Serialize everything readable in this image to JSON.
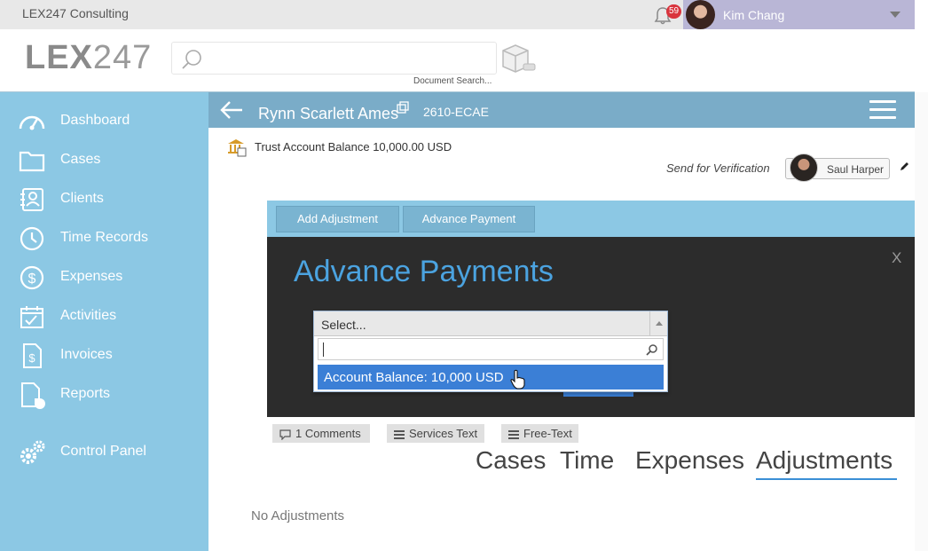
{
  "topbar": {
    "company": "LEX247 Consulting",
    "notification_count": "59",
    "user_name": "Kim Chang"
  },
  "logo": {
    "part1": "LEX",
    "part2": "247"
  },
  "search": {
    "placeholder": "",
    "caption": "Document Search..."
  },
  "sidebar": {
    "items": [
      {
        "label": "Dashboard",
        "icon": "gauge-icon"
      },
      {
        "label": "Cases",
        "icon": "folder-icon"
      },
      {
        "label": "Clients",
        "icon": "contacts-icon"
      },
      {
        "label": "Time Records",
        "icon": "clock-icon"
      },
      {
        "label": "Expenses",
        "icon": "dollar-icon"
      },
      {
        "label": "Activities",
        "icon": "calendar-icon"
      },
      {
        "label": "Invoices",
        "icon": "invoice-icon"
      },
      {
        "label": "Reports",
        "icon": "report-icon"
      },
      {
        "label": "Control Panel",
        "icon": "gears-icon"
      }
    ]
  },
  "case": {
    "name": "Rynn Scarlett Ames",
    "code": "2610-ECAE",
    "trust_balance": "Trust Account Balance 10,000.00 USD",
    "send_for_verification": "Send for Verification",
    "verifier": "Saul Harper"
  },
  "actions": {
    "add_adjustment": "Add Adjustment",
    "advance_payment": "Advance Payment"
  },
  "modal": {
    "title": "Advance Payments",
    "close": "X",
    "select_placeholder": "Select...",
    "option": "Account Balance: 10,000 USD"
  },
  "chips": {
    "comments": "1 Comments",
    "services_text": "Services Text",
    "free_text": "Free-Text"
  },
  "tabs": {
    "cases": "Cases",
    "time": "Time",
    "expenses": "Expenses",
    "adjustments": "Adjustments"
  },
  "empty_state": "No Adjustments",
  "colors": {
    "sidebar": "#8cc8e4",
    "header": "#7aacc8",
    "accent": "#3b7fd6",
    "modal_bg": "#2c2c2c"
  }
}
